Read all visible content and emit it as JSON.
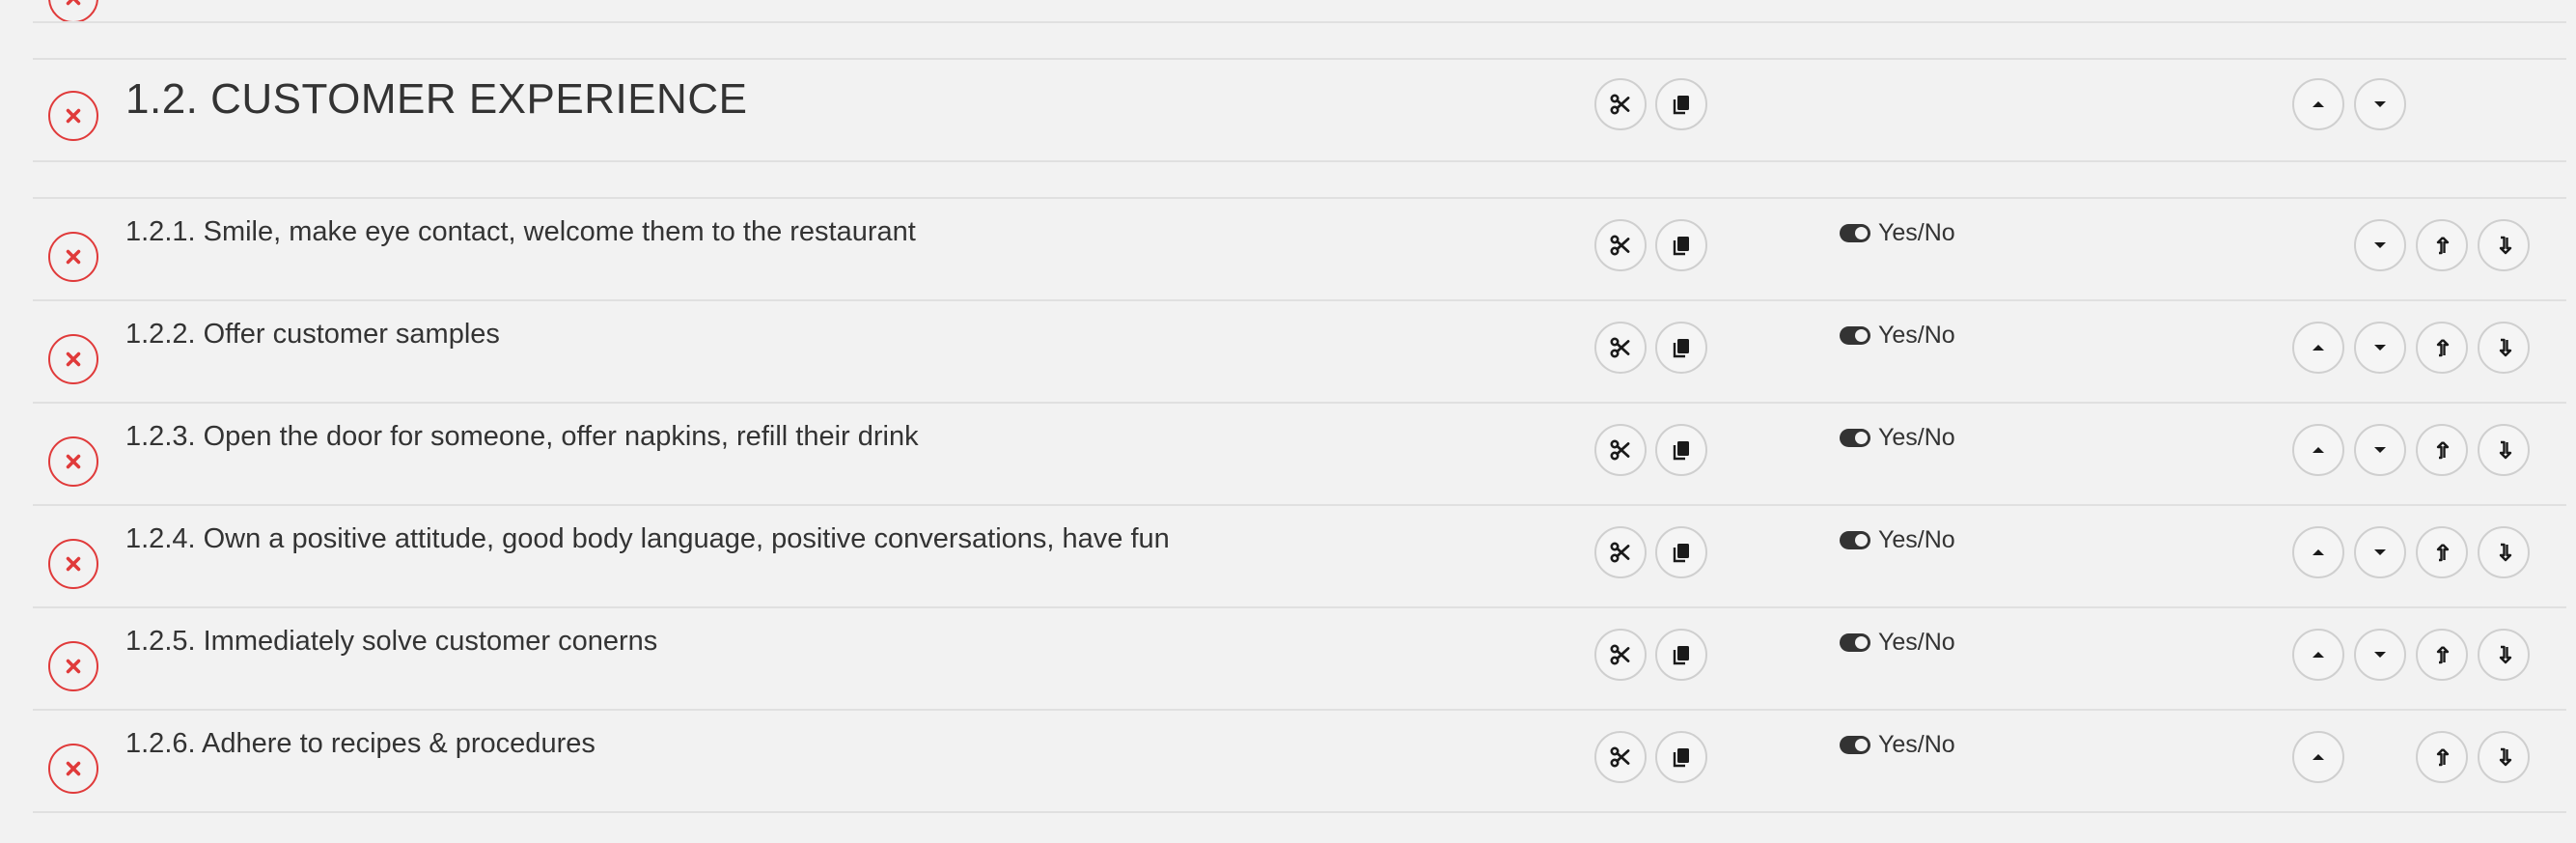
{
  "section": {
    "title": "1.2. CUSTOMER EXPERIENCE"
  },
  "items": [
    {
      "label": "1.2.1. Smile, make eye contact, welcome them to the restaurant",
      "answer_type": "Yes/No"
    },
    {
      "label": "1.2.2. Offer customer samples",
      "answer_type": "Yes/No"
    },
    {
      "label": "1.2.3. Open the door for someone, offer napkins, refill their drink",
      "answer_type": "Yes/No"
    },
    {
      "label": "1.2.4. Own a positive attitude, good body language, positive conversations, have fun",
      "answer_type": "Yes/No"
    },
    {
      "label": "1.2.5. Immediately solve customer conerns",
      "answer_type": "Yes/No"
    },
    {
      "label": "1.2.6. Adhere to recipes & procedures",
      "answer_type": "Yes/No"
    }
  ],
  "icons": {
    "delete": "close-icon",
    "cut": "scissors-icon",
    "copy": "copy-icon",
    "move_up": "caret-up-icon",
    "move_down": "caret-down-icon",
    "indent_up": "arrow-turn-up-icon",
    "indent_down": "arrow-turn-down-icon",
    "toggle": "toggle-on-icon"
  },
  "colors": {
    "background": "#f2f2f2",
    "delete_accent": "#e03a3a",
    "text": "#333333",
    "button_border": "#cfcfcf"
  }
}
